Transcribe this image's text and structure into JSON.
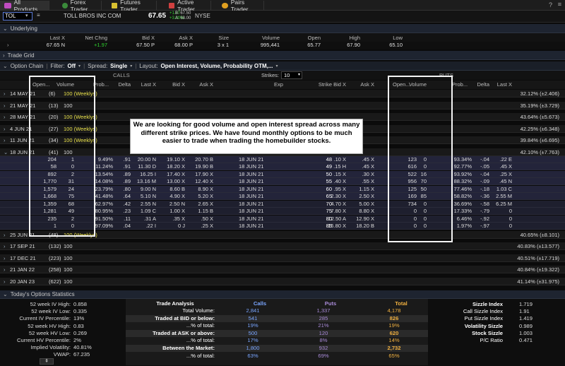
{
  "tabs": [
    {
      "label": "All Products",
      "active": true
    },
    {
      "label": "Forex Trader"
    },
    {
      "label": "Futures Trader"
    },
    {
      "label": "Active Trader"
    },
    {
      "label": "Pairs Trader"
    }
  ],
  "symbol": {
    "ticker": "TOL",
    "name": "TOLL BROS INC COM",
    "price": "67.65",
    "chg1": "+1.97",
    "chg2": "+3.00%",
    "bid": "B: 67.50",
    "ask": "A: 68.00",
    "exchange": "NYSE"
  },
  "underlying": {
    "title": "Underlying",
    "headers": [
      "Last X",
      "Net Chng",
      "Bid X",
      "Ask X",
      "Size",
      "Volume",
      "Open",
      "High",
      "Low"
    ],
    "values": [
      "67.65 N",
      "+1.97",
      "67.50 P",
      "68.00 P",
      "3 x 1",
      "995,441",
      "65.77",
      "67.90",
      "65.10"
    ]
  },
  "trade_grid": {
    "title": "Trade Grid"
  },
  "chain": {
    "title": "Option Chain",
    "filter_label": "Filter:",
    "filter_value": "Off",
    "spread_label": "Spread:",
    "spread_value": "Single",
    "layout_label": "Layout:",
    "layout_value": "Open Interest, Volume, Probability OTM,...",
    "calls_label": "CALLS",
    "puts_label": "PUTS",
    "strikes_label": "Strikes:",
    "strikes_value": "10",
    "headers_calls": [
      "Open...",
      "Volume",
      "Prob...",
      "Delta",
      "Last X",
      "Bid X",
      "Ask X"
    ],
    "headers_mid": [
      "Exp",
      "Strike"
    ],
    "headers_puts": [
      "Bid X",
      "Ask X",
      "Open...",
      "Volume",
      "Prob...",
      "Delta",
      "Last X"
    ],
    "expirations_top": [
      {
        "label": "14 MAY 21",
        "days": "(6)",
        "mult": "100 (Weeklys)",
        "iv": "32.12% (±2.406)"
      },
      {
        "label": "21 MAY 21",
        "days": "(13)",
        "mult": "100",
        "iv": "35.19% (±3.729)"
      },
      {
        "label": "28 MAY 21",
        "days": "(20)",
        "mult": "100 (Weeklys)",
        "iv": "43.64% (±5.673)"
      },
      {
        "label": "4 JUN 21",
        "days": "(27)",
        "mult": "100 (Weeklys)",
        "iv": "42.25% (±6.348)"
      },
      {
        "label": "11 JUN 21",
        "days": "(34)",
        "mult": "100 (Weeklys)",
        "iv": "39.84% (±6.695)"
      },
      {
        "label": "18 JUN 21",
        "days": "(41)",
        "mult": "100",
        "iv": "42.10% (±7.763)"
      }
    ],
    "rows": [
      {
        "oi": "204",
        "vol": "1",
        "prob": "9.49%",
        "delta": ".91",
        "last": "20.00 N",
        "bid": "19.10 X",
        "ask": "20.70 B",
        "exp": "18 JUN 21",
        "strike": "48",
        "pbid": ".10 X",
        "pask": ".45 X",
        "poi": "123",
        "pvol": "0",
        "pprob": "93.34%",
        "pdelta": "-.04",
        "plast": ".22 E"
      },
      {
        "oi": "58",
        "vol": "0",
        "prob": "11.24%",
        "delta": ".91",
        "last": "11.30 D",
        "bid": "18.20 X",
        "ask": "19.90 B",
        "exp": "18 JUN 21",
        "strike": "49",
        "pbid": ".15 H",
        "pask": ".45 X",
        "poi": "616",
        "pvol": "0",
        "pprob": "92.77%",
        "pdelta": "-.05",
        "plast": ".45 X"
      },
      {
        "oi": "892",
        "vol": "2",
        "prob": "13.54%",
        "delta": ".89",
        "last": "16.25 I",
        "bid": "17.40 X",
        "ask": "17.90 X",
        "exp": "18 JUN 21",
        "strike": "50",
        "pbid": ".15 X",
        "pask": ".30 X",
        "poi": "522",
        "pvol": "16",
        "pprob": "93.92%",
        "pdelta": "-.04",
        "plast": ".25 X"
      },
      {
        "oi": "1,770",
        "vol": "31",
        "prob": "14.08%",
        "delta": ".89",
        "last": "13.16 M",
        "bid": "13.00 X",
        "ask": "12.40 X",
        "exp": "18 JUN 21",
        "strike": "55",
        "pbid": ".40 X",
        "pask": ".55 X",
        "poi": "956",
        "pvol": "70",
        "pprob": "88.32%",
        "pdelta": "-.09",
        "plast": ".45 N"
      },
      {
        "oi": "1,579",
        "vol": "24",
        "prob": "23.79%",
        "delta": ".80",
        "last": "9.00 N",
        "bid": "8.60 B",
        "ask": "8.90 X",
        "exp": "18 JUN 21",
        "strike": "60",
        "pbid": ".95 X",
        "pask": "1.15 X",
        "poi": "125",
        "pvol": "50",
        "pprob": "77.46%",
        "pdelta": "-.18",
        "plast": "1.03 C"
      },
      {
        "oi": "1,668",
        "vol": "75",
        "prob": "41.48%",
        "delta": ".64",
        "last": "5.10 N",
        "bid": "4.90 X",
        "ask": "5.20 X",
        "exp": "18 JUN 21",
        "strike": "65",
        "pbid": "2.30 X",
        "pask": "2.50 X",
        "poi": "169",
        "pvol": "85",
        "pprob": "58.82%",
        "pdelta": "-.36",
        "plast": "2.55 M"
      },
      {
        "oi": "1,359",
        "vol": "68",
        "prob": "62.97%",
        "delta": ".42",
        "last": "2.55 N",
        "bid": "2.50 N",
        "ask": "2.65 X",
        "exp": "18 JUN 21",
        "strike": "70",
        "pbid": "4.70 X",
        "pask": "5.00 X",
        "poi": "734",
        "pvol": "0",
        "pprob": "36.69%",
        "pdelta": "-.58",
        "plast": "6.25 M"
      },
      {
        "oi": "1,281",
        "vol": "49",
        "prob": "80.95%",
        "delta": ".23",
        "last": "1.09 C",
        "bid": "1.00 X",
        "ask": "1.15 B",
        "exp": "18 JUN 21",
        "strike": "75",
        "pbid": "7.80 X",
        "pask": "8.80 X",
        "poi": "0",
        "pvol": "0",
        "pprob": "17.33%",
        "pdelta": "-.79",
        "plast": "0"
      },
      {
        "oi": "235",
        "vol": "2",
        "prob": "91.50%",
        "delta": ".11",
        "last": ".31 A",
        "bid": ".35 X",
        "ask": ".50 X",
        "exp": "18 JUN 21",
        "strike": "80",
        "pbid": "12.50 A",
        "pask": "12.90 X",
        "poi": "0",
        "pvol": "0",
        "pprob": "6.46%",
        "pdelta": "-.92",
        "plast": "0"
      },
      {
        "oi": "1",
        "vol": "0",
        "prob": "97.09%",
        "delta": ".04",
        "last": ".22 I",
        "bid": "0 J",
        "ask": ".25 X",
        "exp": "18 JUN 21",
        "strike": "85",
        "pbid": "16.80 X",
        "pask": "18.20 B",
        "poi": "0",
        "pvol": "0",
        "pprob": "1.97%",
        "pdelta": "-.97",
        "plast": "0"
      }
    ],
    "expirations_bottom": [
      {
        "label": "25 JUN 21",
        "days": "(48)",
        "mult": "100 (Weeklys)",
        "iv": "40.65% (±8.101)"
      },
      {
        "label": "17 SEP 21",
        "days": "(132)",
        "mult": "100",
        "iv": "40.83% (±13.577)"
      },
      {
        "label": "17 DEC 21",
        "days": "(223)",
        "mult": "100",
        "iv": "40.51% (±17.719)"
      },
      {
        "label": "21 JAN 22",
        "days": "(258)",
        "mult": "100",
        "iv": "40.84% (±19.322)"
      },
      {
        "label": "20 JAN 23",
        "days": "(622)",
        "mult": "100",
        "iv": "41.14% (±31.975)"
      }
    ]
  },
  "annotation": "We are looking for good volume and open interest spread across many different strike prices. We have found monthly options to be much easier to trade when trading the homebuilder stocks.",
  "stats": {
    "title": "Today's Options Statistics",
    "left": [
      {
        "k": "52 week IV High:",
        "v": "0.858"
      },
      {
        "k": "52 week IV Low:",
        "v": "0.335"
      },
      {
        "k": "Current IV Percentile:",
        "v": "13%"
      },
      {
        "k": "52 week HV High:",
        "v": "0.83"
      },
      {
        "k": "52 week HV Low:",
        "v": "0.269"
      },
      {
        "k": "Current HV Percentile:",
        "v": "2%"
      },
      {
        "k": "Implied Volatility:",
        "v": "40.81%"
      },
      {
        "k": "VWAP:",
        "v": "67.235"
      }
    ],
    "mid_headers": [
      "Trade Analysis",
      "Calls",
      "Puts",
      "Total"
    ],
    "mid": [
      {
        "k": "Total Volume:",
        "c": "2,841",
        "p": "1,337",
        "t": "4,178",
        "bold": false
      },
      {
        "k": "Traded at BID or below:",
        "c": "541",
        "p": "285",
        "t": "826",
        "bold": true
      },
      {
        "k": "...% of total:",
        "c": "19%",
        "p": "21%",
        "t": "19%",
        "bold": false
      },
      {
        "k": "Traded at ASK or above:",
        "c": "500",
        "p": "120",
        "t": "620",
        "bold": true
      },
      {
        "k": "...% of total:",
        "c": "17%",
        "p": "8%",
        "t": "14%",
        "bold": false
      },
      {
        "k": "Between the Market:",
        "c": "1,800",
        "p": "932",
        "t": "2,732",
        "bold": true
      },
      {
        "k": "...% of total:",
        "c": "63%",
        "p": "69%",
        "t": "65%",
        "bold": false
      }
    ],
    "right": [
      {
        "k": "Sizzle Index",
        "v": "1.719",
        "bold": true
      },
      {
        "k": "Call Sizzle Index",
        "v": "1.91",
        "bold": false
      },
      {
        "k": "Put Sizzle Index",
        "v": "1.419",
        "bold": false
      },
      {
        "k": "Volatility Sizzle",
        "v": "0.989",
        "bold": true
      },
      {
        "k": "Stock Sizzle",
        "v": "1.003",
        "bold": true
      },
      {
        "k": "P/C Ratio",
        "v": "0.471",
        "bold": false
      }
    ]
  }
}
